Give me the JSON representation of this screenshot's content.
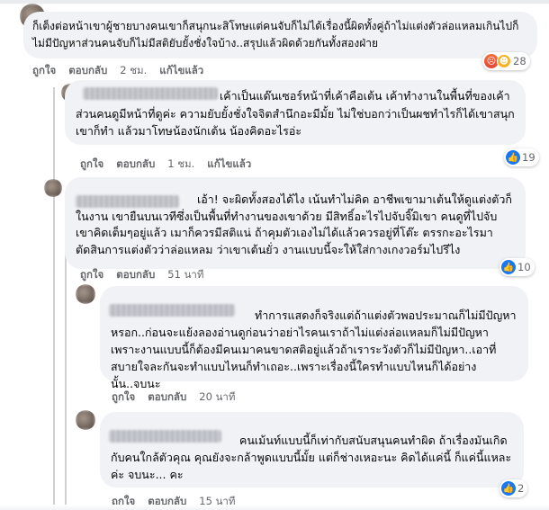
{
  "comments": [
    {
      "id": "c1",
      "text": "ก็เต็งต่อหน้าเขาผู้ชายบางคนเขาก็สนุกนะสิโทษแต่คนจับก็ไม่ได้เรื่องนี้ผิดทั้งคู่ถ้าไม่แต่งตัวล่อแหลมเกินไปก็ไม่มีปัญหาส่วนคนจับก็ไม่มีสติยับยั้งชั่งใจบ้าง..สรุปแล้วผิดด้วยกันทั้งสองฝ่าย",
      "like_label": "ถูกใจ",
      "reply_label": "ตอบกลับ",
      "time": "2 ชม.",
      "edited": "แก้ไขแล้ว",
      "reaction_count": "28",
      "reactions": [
        "angry",
        "haha"
      ]
    },
    {
      "id": "c2",
      "text": "เค้าเป็นแด๊นเซอร์หน้าที่เค้าคือเต้น เค้าทำงานในพื้นที่ของเค้า ส่วนคนดูมีหน้าที่ดูค่ะ ความยับยั้งชั่งใจจิตสำนึกอะมีมั้ย ไม่ใช่บอกว่าเป็นผชทำไรก็ได้เขาสนุกเขาก็ทำ แล้วมาโทษน้องนักเต้น น้องคิดอะไรอ่ะ",
      "like_label": "ถูกใจ",
      "reply_label": "ตอบกลับ",
      "time": "1 ชม.",
      "edited": "แก้ไขแล้ว",
      "reaction_count": "19",
      "reactions": [
        "like"
      ]
    },
    {
      "id": "c3",
      "text": "เอ้า! จะผิดทั้งสองได้ไง เน้นทำไม่คิด อาชีพเขามาเต้นให้ดูแต่งตัวก็ในงาน เขายืนบนเวทีซึ่งเป็นพื้นที่ทำงานของเขาด้วย มีสิทธิ์อะไรไปจับจิ๊มิเขา คนดูที่ไปจับเขาคิดเต็มๆอยู่แล้ว เมาก็ควรมีสติแน่ ถ้าคุมตัวเองไม่ได้แล้วควรอยู่ที่โต๊ะ ตรรกะอะไรมาตัดสินการแต่งตัวว่าล่อแหลม ว่าเขาเต้นยั่ว งานแบบนี้จะให้ใส่กางเกงวอร์มไปรึไง",
      "like_label": "ถูกใจ",
      "reply_label": "ตอบกลับ",
      "time": "51 นาที",
      "reaction_count": "10",
      "reactions": [
        "like"
      ]
    },
    {
      "id": "c4",
      "text": "ทำการแสดงก็จริงแต่ถ้าแต่งตัวพอประมาณก็ไม่มีปัญหาหรอก..ก่อนจะแย้งลองอ่านดูก่อนว่าอย่าไรคนเราถ้าไม่แต่งล่อแหลมก็ไม่มีปัญหาเพราะงานแบบนี้ก็ต้องมีคนเมาคนขาดสติอยู่แล้วถ้าเราระวังตัวก็ไม่มีปัญหา..เอาที่สบายใจละกันจะทำแบบไหนก็ทำเถอะ..เพราะเรื่องนี้ใครทำแบบไหนก็ได้อย่างนั้น..จบนะ",
      "like_label": "ถูกใจ",
      "reply_label": "ตอบกลับ",
      "time": "20 นาที"
    },
    {
      "id": "c5",
      "text": "คนเม้นท์แบบนี้ก็เท่ากับสนับสนุนคนทำผิด ถ้าเรื่องมันเกิดกับคนใกล้ตัวคุณ คุณยังจะกล้าพูดแบบนี้มั้ย แต่ก็ช่างเหอะนะ คิดได้แค่นี้ ก็แค่นี้แหละค่ะ จบนะ... คะ",
      "like_label": "ถูกใจ",
      "reply_label": "ตอบกลับ",
      "time": "15 นาที",
      "reaction_count": "2",
      "reactions": [
        "like"
      ]
    }
  ]
}
